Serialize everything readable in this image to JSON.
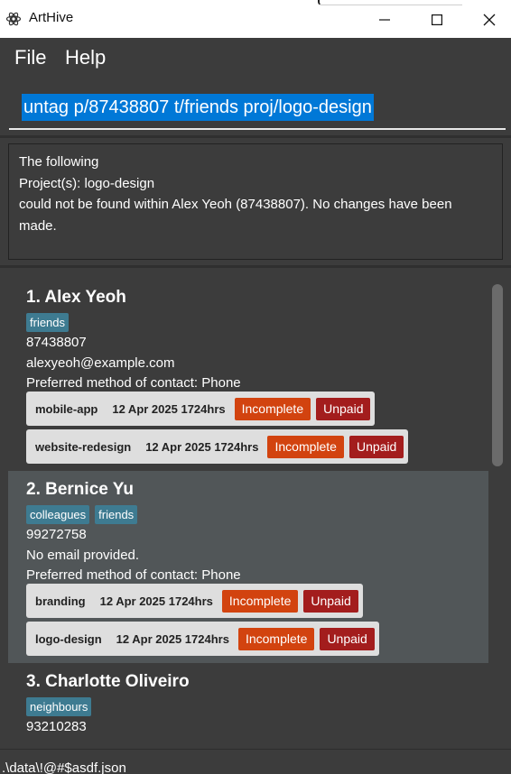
{
  "window": {
    "title": "ArtHive",
    "icon": "app-logo-icon",
    "controls": [
      "minimize-icon",
      "maximize-icon",
      "close-icon"
    ]
  },
  "menu": {
    "items": [
      {
        "label": "File"
      },
      {
        "label": "Help"
      }
    ]
  },
  "command": {
    "value": "untag p/87438807 t/friends proj/logo-design",
    "selected": true
  },
  "result": {
    "lines": [
      "The following",
      "Project(s): logo-design",
      "could not be found within Alex Yeoh (87438807). No changes have been made."
    ]
  },
  "persons": [
    {
      "index_name": "1. Alex Yeoh",
      "tags": [
        "friends"
      ],
      "phone": "87438807",
      "email": "alexyeoh@example.com",
      "contact": "Preferred method of contact: Phone",
      "projects": [
        {
          "name": "mobile-app",
          "deadline": "12 Apr 2025 1724hrs",
          "status": "Incomplete",
          "payment": "Unpaid"
        },
        {
          "name": "website-redesign",
          "deadline": "12 Apr 2025 1724hrs",
          "status": "Incomplete",
          "payment": "Unpaid"
        }
      ]
    },
    {
      "index_name": "2. Bernice Yu",
      "tags": [
        "colleagues",
        "friends"
      ],
      "phone": "99272758",
      "email": "No email provided.",
      "contact": "Preferred method of contact: Phone",
      "projects": [
        {
          "name": "branding",
          "deadline": "12 Apr 2025 1724hrs",
          "status": "Incomplete",
          "payment": "Unpaid"
        },
        {
          "name": "logo-design",
          "deadline": "12 Apr 2025 1724hrs",
          "status": "Incomplete",
          "payment": "Unpaid"
        }
      ]
    },
    {
      "index_name": "3. Charlotte Oliveiro",
      "tags": [
        "neighbours"
      ],
      "phone": "93210283"
    }
  ],
  "status_bar": {
    "path": ".\\data\\!@#$asdf.json"
  },
  "colors": {
    "background": "#3c3c3c",
    "selected_card": "#515658",
    "tag": "#3e7b91",
    "status_incomplete": "#d2430f",
    "payment_unpaid": "#a31d1d",
    "selection_highlight": "#0078d7"
  }
}
